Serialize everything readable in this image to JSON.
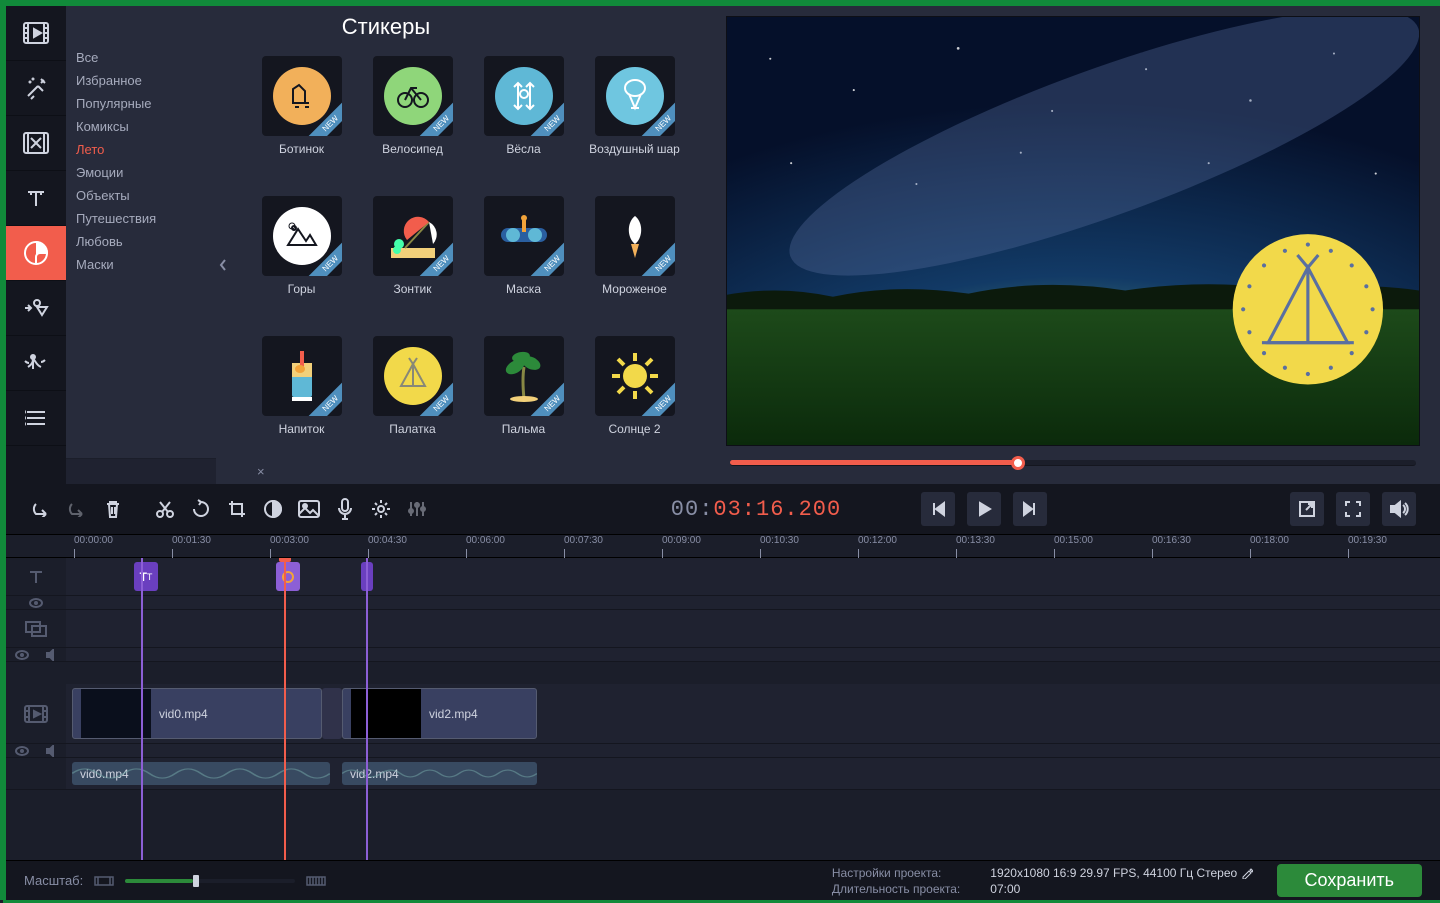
{
  "panel": {
    "title": "Стикеры",
    "categories": [
      "Все",
      "Избранное",
      "Популярные",
      "Комиксы",
      "Лето",
      "Эмоции",
      "Объекты",
      "Путешествия",
      "Любовь",
      "Маски"
    ],
    "activeCategoryIndex": 4,
    "searchPlaceholder": ""
  },
  "stickers": [
    {
      "label": "Ботинок",
      "badge": "NEW"
    },
    {
      "label": "Велосипед",
      "badge": "NEW"
    },
    {
      "label": "Вёсла",
      "badge": "NEW"
    },
    {
      "label": "Воздушный шар",
      "badge": "NEW"
    },
    {
      "label": "Горы",
      "badge": "NEW"
    },
    {
      "label": "Зонтик",
      "badge": "NEW"
    },
    {
      "label": "Маска",
      "badge": "NEW"
    },
    {
      "label": "Мороженое",
      "badge": "NEW"
    },
    {
      "label": "Напиток",
      "badge": "NEW"
    },
    {
      "label": "Палатка",
      "badge": "NEW"
    },
    {
      "label": "Пальма",
      "badge": "NEW"
    },
    {
      "label": "Солнце 2",
      "badge": "NEW"
    }
  ],
  "preview": {
    "scrubPosPercent": 42,
    "timecode": {
      "hours": "00",
      "rest": "03:16.200",
      "sep1": ":",
      "sep2": "."
    }
  },
  "ruler": [
    "00:00:00",
    "00:01:30",
    "00:03:00",
    "00:04:30",
    "00:06:00",
    "00:07:30",
    "00:09:00",
    "00:10:30",
    "00:12:00",
    "00:13:30",
    "00:15:00",
    "00:16:30",
    "00:18:00",
    "00:19:30"
  ],
  "clips": {
    "title1": "T",
    "video1": "vid0.mp4",
    "video2": "vid2.mp4",
    "audio1": "vid0.mp4",
    "audio2": "vid2.mp4"
  },
  "footer": {
    "zoomLabel": "Масштаб:",
    "settingsLabel": "Настройки проекта:",
    "settingsValue": "1920x1080 16:9 29.97 FPS, 44100 Гц Стерео",
    "durationLabel": "Длительность проекта:",
    "durationValue": "07:00",
    "save": "Сохранить"
  }
}
